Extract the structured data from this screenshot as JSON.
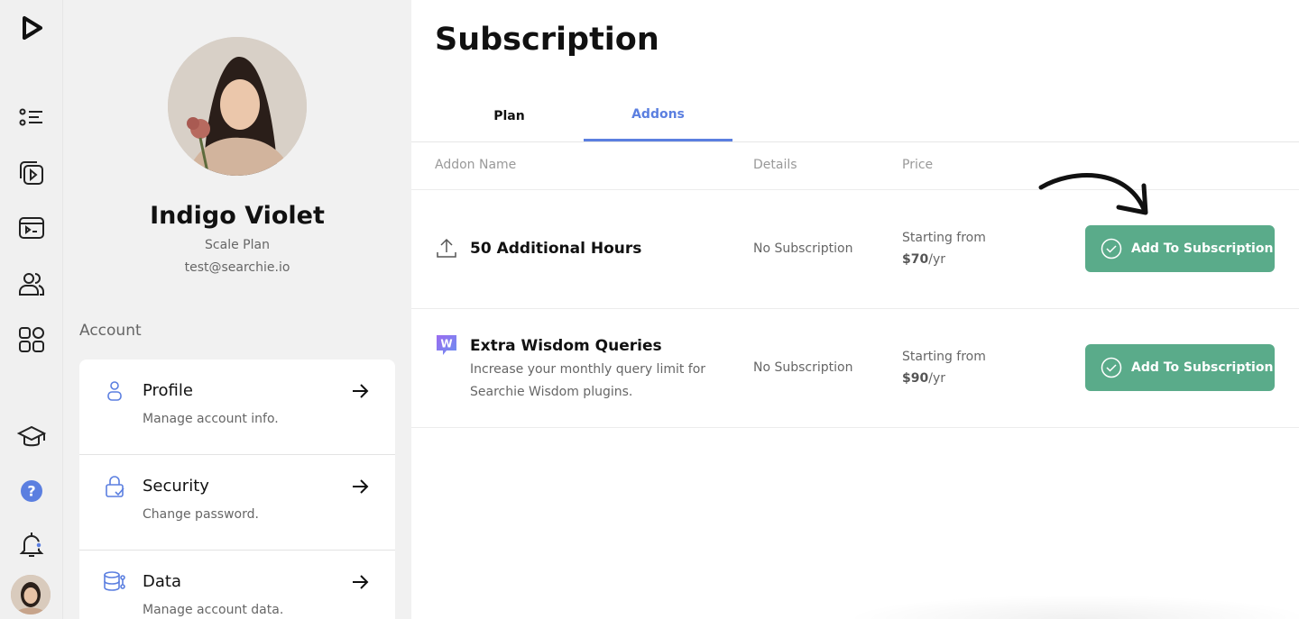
{
  "profile": {
    "name": "Indigo Violet",
    "plan": "Scale Plan",
    "email": "test@searchie.io"
  },
  "account": {
    "section_label": "Account",
    "items": [
      {
        "title": "Profile",
        "subtitle": "Manage account info.",
        "icon": "user-icon"
      },
      {
        "title": "Security",
        "subtitle": "Change password.",
        "icon": "lock-check-icon"
      },
      {
        "title": "Data",
        "subtitle": "Manage account data.",
        "icon": "database-icon"
      }
    ]
  },
  "page": {
    "title": "Subscription"
  },
  "tabs": [
    {
      "label": "Plan",
      "active": false
    },
    {
      "label": "Addons",
      "active": true
    }
  ],
  "table": {
    "headers": {
      "name": "Addon Name",
      "details": "Details",
      "price": "Price"
    },
    "rows": [
      {
        "icon": "upload-icon",
        "title": "50 Additional Hours",
        "description": "",
        "details": "No Subscription",
        "price_prefix": "Starting from",
        "price_amount": "$70",
        "price_period": "/yr",
        "button_label": "Add To Subscription"
      },
      {
        "icon": "wisdom-logo-icon",
        "title": "Extra Wisdom Queries",
        "description": "Increase your monthly query limit for Searchie Wisdom plugins.",
        "details": "No Subscription",
        "price_prefix": "Starting from",
        "price_amount": "$90",
        "price_period": "/yr",
        "button_label": "Add To Subscription"
      }
    ]
  },
  "colors": {
    "accent_blue": "#5b7fe0",
    "button_green": "#5aab8a",
    "rail_bg": "#f0f0f0",
    "panel_bg": "#f1f1f1"
  }
}
